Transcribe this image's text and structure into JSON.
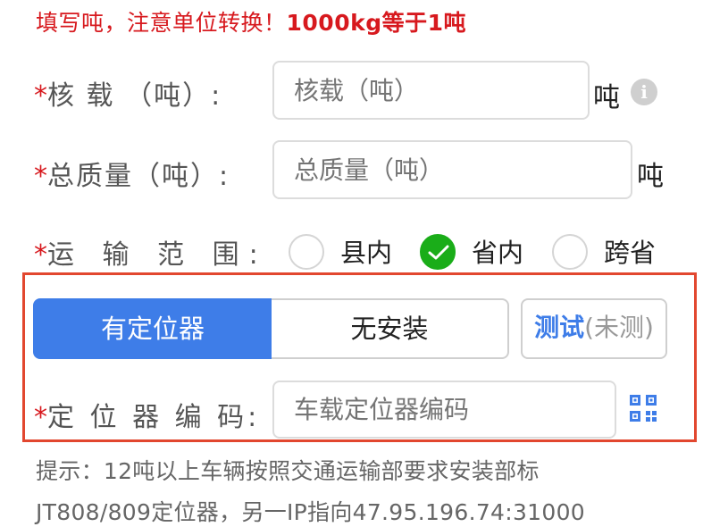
{
  "warning": {
    "part1": "填写吨，注意单位转换！",
    "part2": "1000kg",
    "part3": "等于",
    "part4": "1",
    "part5": "吨"
  },
  "load": {
    "label": "核 载 （吨）:",
    "placeholder": "核载（吨）",
    "unit": "吨",
    "info_icon": "info-icon"
  },
  "gross": {
    "label": "总质量（吨）:",
    "placeholder": "总质量（吨）",
    "unit": "吨"
  },
  "scope": {
    "label": "运 输 范 围:",
    "options": [
      {
        "label": "县内",
        "selected": false
      },
      {
        "label": "省内",
        "selected": true
      },
      {
        "label": "跨省",
        "selected": false
      }
    ]
  },
  "locator": {
    "tabs": [
      {
        "label": "有定位器",
        "active": true
      },
      {
        "label": "无安装",
        "active": false
      }
    ],
    "test_label": "测试",
    "test_status": "(未测)",
    "code_label": "定 位 器 编 码:",
    "code_placeholder": "车载定位器编码",
    "scan_icon": "qr-code-icon"
  },
  "hint": {
    "line1": "提示：12吨以上车辆按照交通运输部要求安装部标",
    "line2": "JT808/809定位器，另一IP指向47.95.196.74:31000"
  },
  "colors": {
    "required_star": "#d7191e",
    "accent_blue": "#3e7de8",
    "radio_green": "#1aad19",
    "highlight_frame": "#e2472f"
  }
}
